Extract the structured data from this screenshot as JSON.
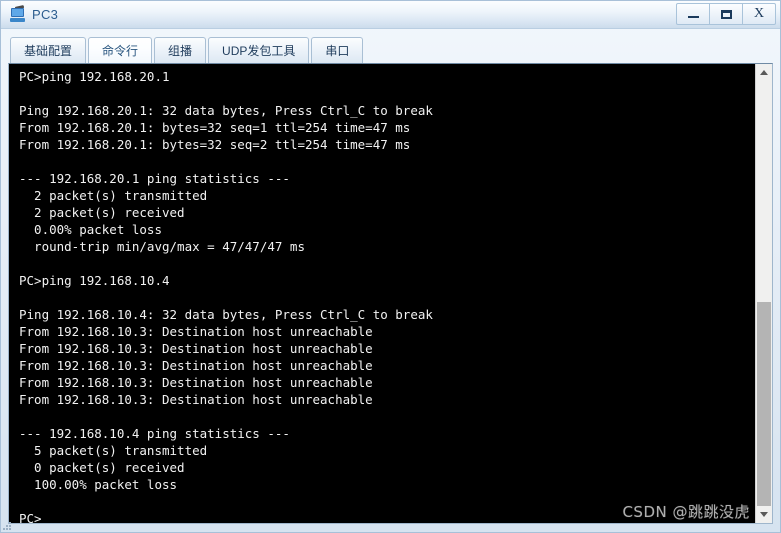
{
  "window": {
    "title": "PC3",
    "icon": "pc-computer-icon",
    "controls": {
      "minimize": "_",
      "maximize": "□",
      "close": "X"
    }
  },
  "tabs": [
    {
      "label": "基础配置",
      "active": false
    },
    {
      "label": "命令行",
      "active": true
    },
    {
      "label": "组播",
      "active": false
    },
    {
      "label": "UDP发包工具",
      "active": false
    },
    {
      "label": "串口",
      "active": false
    }
  ],
  "terminal": {
    "lines": [
      "PC>ping 192.168.20.1",
      "",
      "Ping 192.168.20.1: 32 data bytes, Press Ctrl_C to break",
      "From 192.168.20.1: bytes=32 seq=1 ttl=254 time=47 ms",
      "From 192.168.20.1: bytes=32 seq=2 ttl=254 time=47 ms",
      "",
      "--- 192.168.20.1 ping statistics ---",
      "  2 packet(s) transmitted",
      "  2 packet(s) received",
      "  0.00% packet loss",
      "  round-trip min/avg/max = 47/47/47 ms",
      "",
      "PC>ping 192.168.10.4",
      "",
      "Ping 192.168.10.4: 32 data bytes, Press Ctrl_C to break",
      "From 192.168.10.3: Destination host unreachable",
      "From 192.168.10.3: Destination host unreachable",
      "From 192.168.10.3: Destination host unreachable",
      "From 192.168.10.3: Destination host unreachable",
      "From 192.168.10.3: Destination host unreachable",
      "",
      "--- 192.168.10.4 ping statistics ---",
      "  5 packet(s) transmitted",
      "  0 packet(s) received",
      "  100.00% packet loss",
      "",
      "PC>"
    ]
  },
  "scrollbar": {
    "up_arrow": "scroll-up-arrow",
    "down_arrow": "scroll-down-arrow"
  },
  "watermark": {
    "text": "CSDN @跳跳没虎"
  }
}
